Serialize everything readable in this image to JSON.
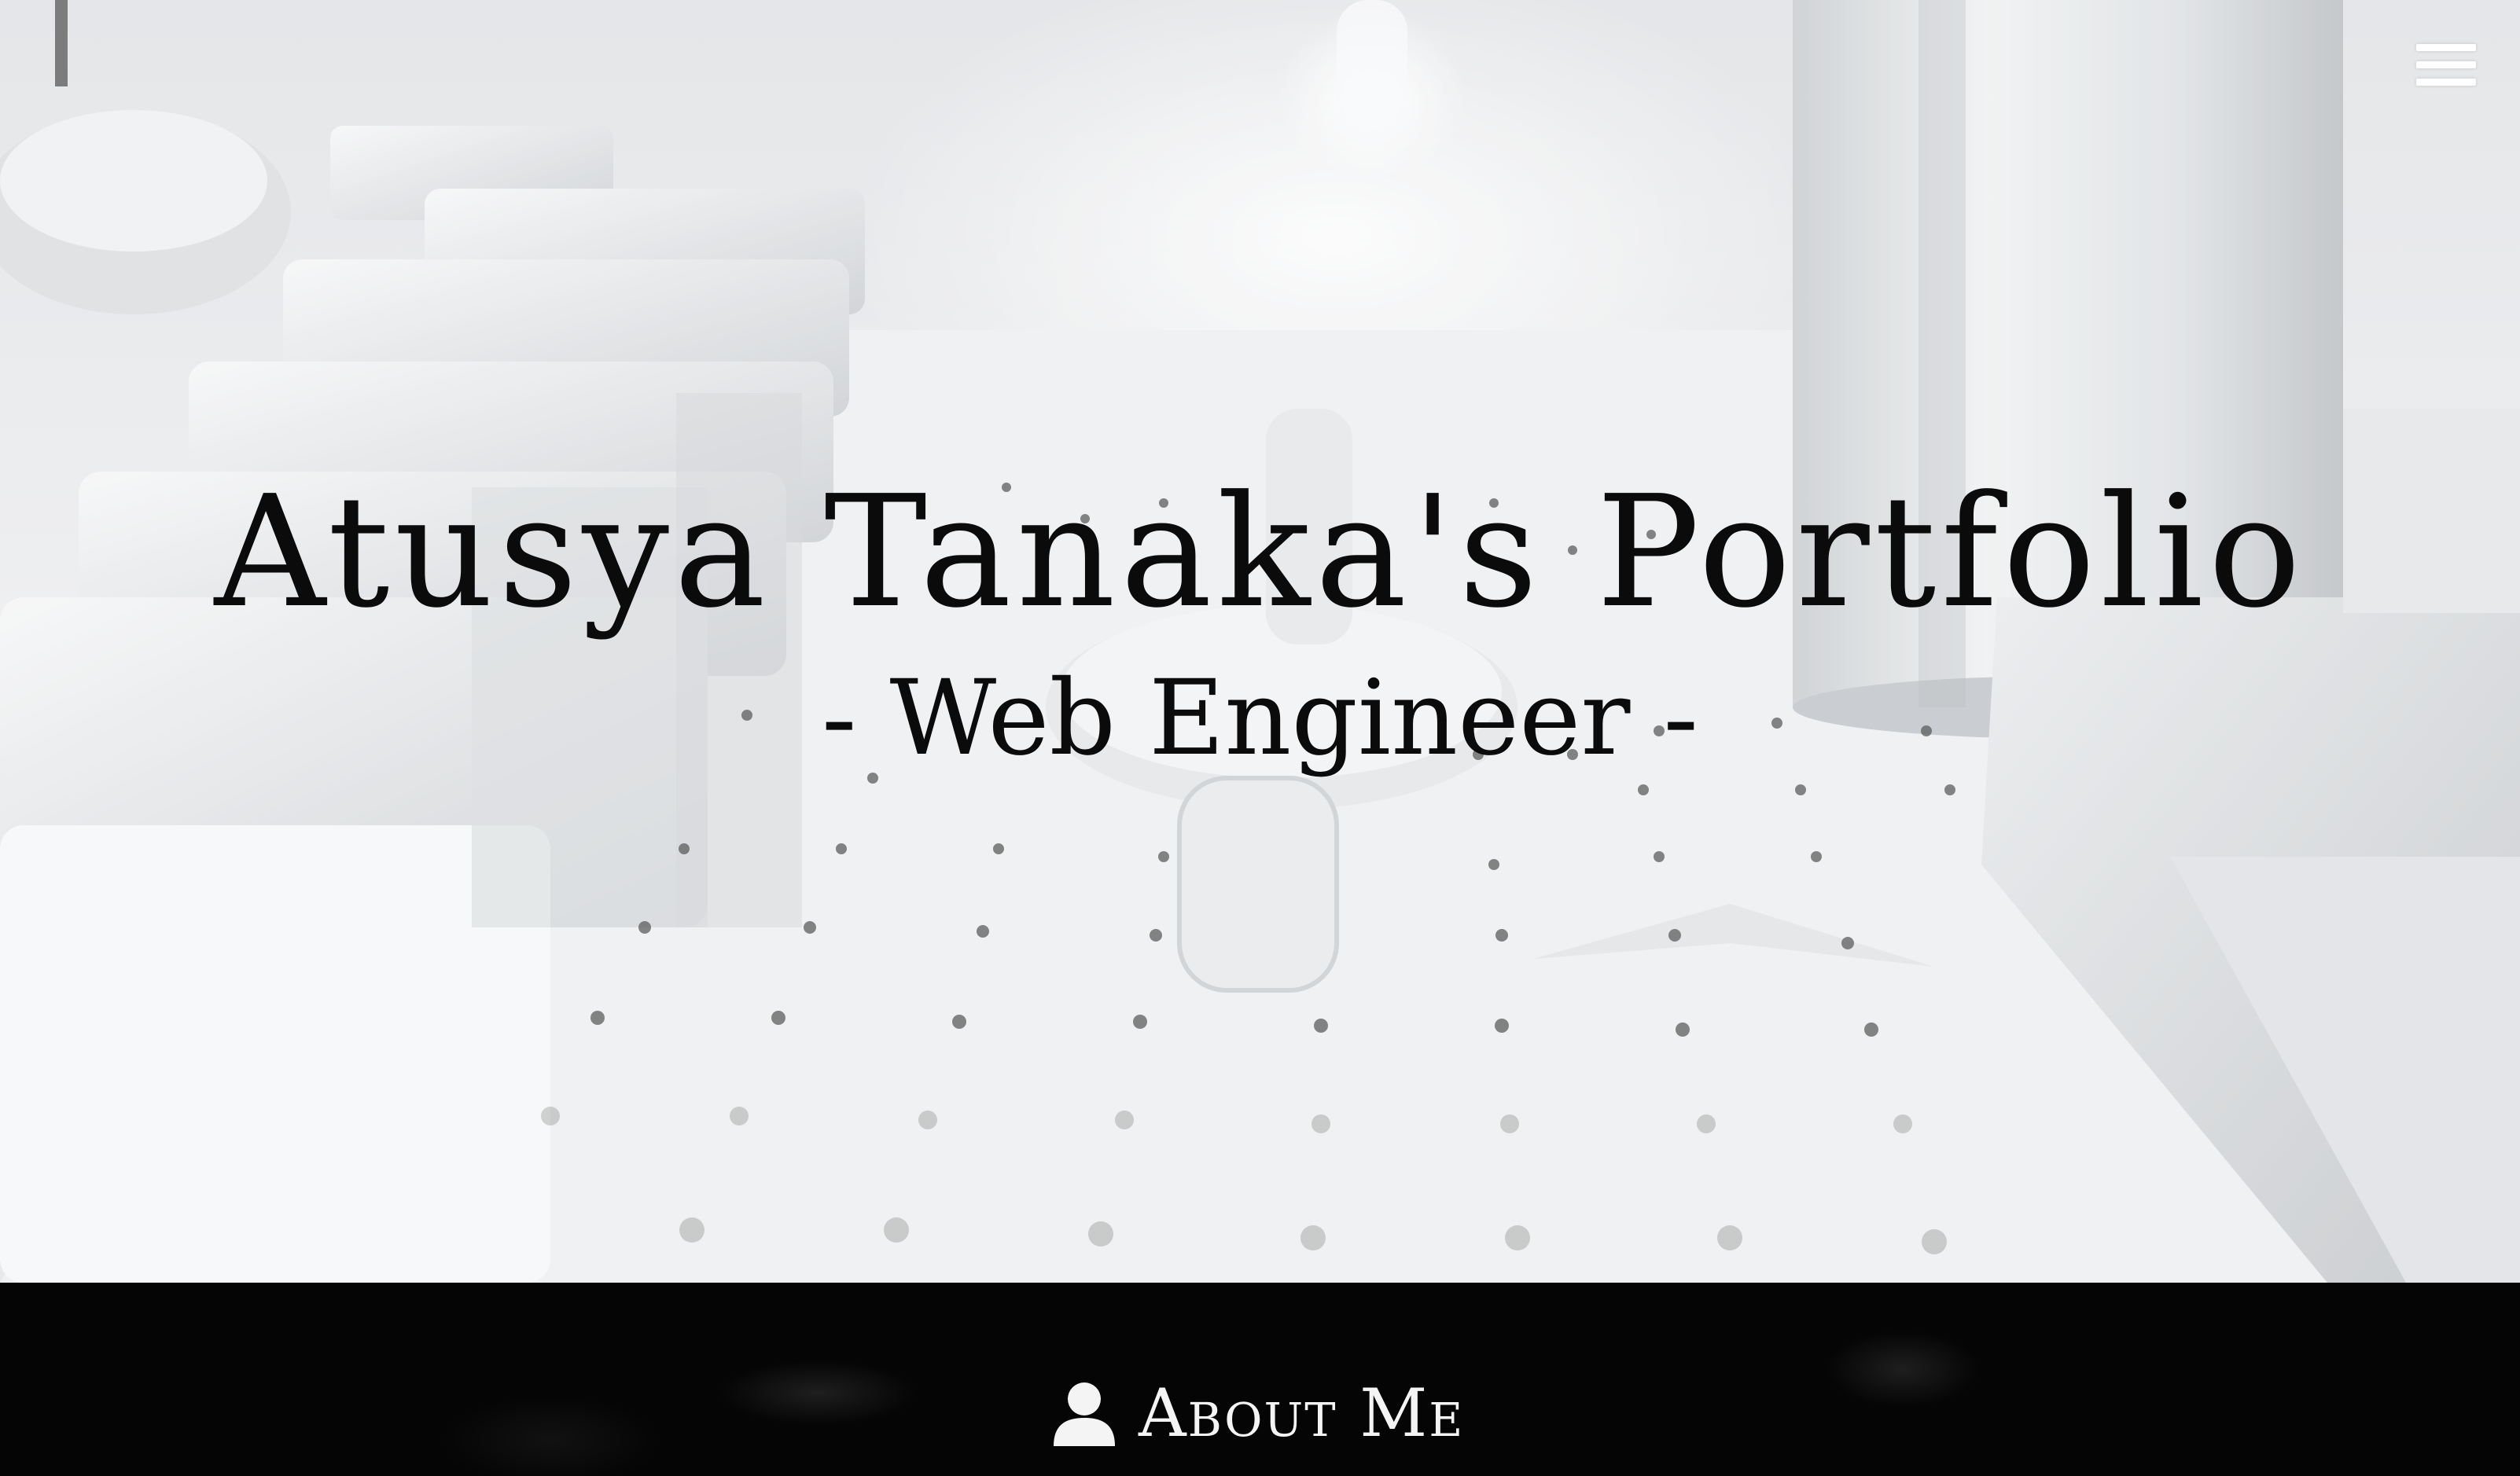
{
  "hero": {
    "title": "Atusya Tanaka's Portfolio",
    "subtitle": "- Web Engineer -"
  },
  "nav": {
    "menu_icon": "hamburger-menu-icon"
  },
  "about": {
    "icon": "user-icon",
    "label": "About Me"
  },
  "colors": {
    "hero_text": "#0b0b0b",
    "about_bar_background": "#050505",
    "about_text": "#f4f4f4",
    "menu_icon": "#ffffff"
  }
}
